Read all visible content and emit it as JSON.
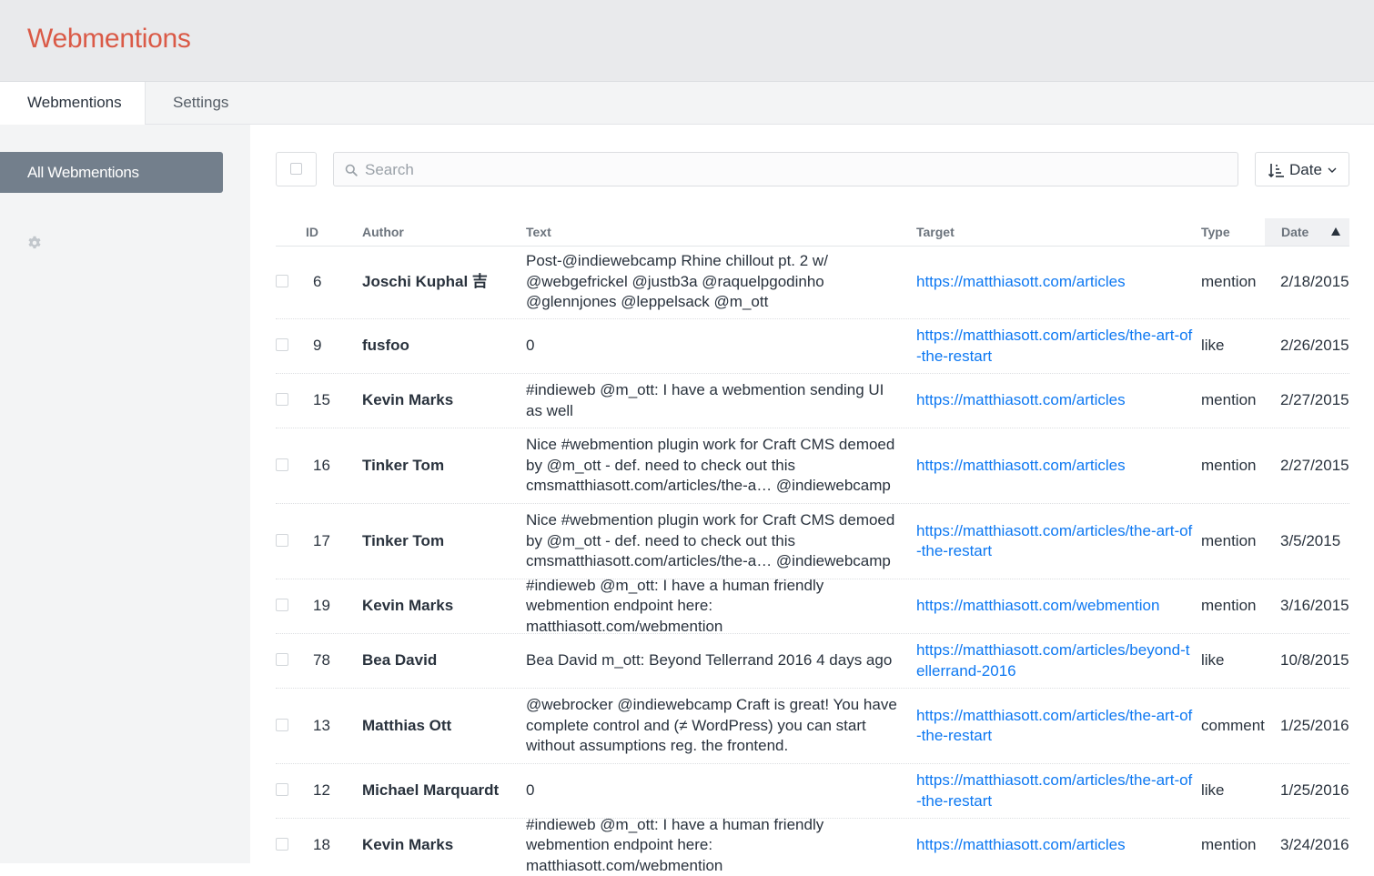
{
  "app": {
    "title": "Webmentions"
  },
  "tabs": [
    {
      "label": "Webmentions"
    },
    {
      "label": "Settings"
    }
  ],
  "sidebar": {
    "items": [
      {
        "label": "All Webmentions"
      }
    ],
    "settings_icon": "gear-icon"
  },
  "toolbar": {
    "search": {
      "placeholder": "Search",
      "value": ""
    },
    "sort": {
      "label": "Date",
      "icon": "sort-ascending-icon"
    }
  },
  "table": {
    "columns": {
      "id": "ID",
      "author": "Author",
      "text": "Text",
      "target": "Target",
      "type": "Type",
      "date": "Date"
    },
    "sorted_by": "Date",
    "sort_direction": "ascending",
    "rows": [
      {
        "id": "6",
        "author": "Joschi Kuphal 吉",
        "text": "Post-@indiewebcamp Rhine chillout pt. 2 w/ @webgefrickel @justb3a @raquelpgodinho @glennjones @leppelsack @m_ott",
        "target": "https://matthiasott.com/articles",
        "type": "mention",
        "date": "2/18/2015"
      },
      {
        "id": "9",
        "author": "fusfoo",
        "text": "0",
        "target": "https://matthiasott.com/articles/the-art-of-the-restart",
        "type": "like",
        "date": "2/26/2015"
      },
      {
        "id": "15",
        "author": "Kevin Marks",
        "text": "#indieweb @m_ott: I have a webmention sending UI as well",
        "target": "https://matthiasott.com/articles",
        "type": "mention",
        "date": "2/27/2015"
      },
      {
        "id": "16",
        "author": "Tinker Tom",
        "text": "Nice #webmention plugin work for Craft CMS demoed by @m_ott - def. need to check out this cmsmatthiasott.com/articles/the-a… @indiewebcamp",
        "target": "https://matthiasott.com/articles",
        "type": "mention",
        "date": "2/27/2015"
      },
      {
        "id": "17",
        "author": "Tinker Tom",
        "text": "Nice #webmention plugin work for Craft CMS demoed by @m_ott - def. need to check out this cmsmatthiasott.com/articles/the-a… @indiewebcamp",
        "target": "https://matthiasott.com/articles/the-art-of-the-restart",
        "type": "mention",
        "date": "3/5/2015"
      },
      {
        "id": "19",
        "author": "Kevin Marks",
        "text": "#indieweb @m_ott: I have a human friendly webmention endpoint here: matthiasott.com/webmention",
        "target": "https://matthiasott.com/webmention",
        "type": "mention",
        "date": "3/16/2015"
      },
      {
        "id": "78",
        "author": "Bea David",
        "text": "Bea David m_ott: Beyond Tellerrand 2016 4 days ago",
        "target": "https://matthiasott.com/articles/beyond-tellerrand-2016",
        "type": "like",
        "date": "10/8/2015"
      },
      {
        "id": "13",
        "author": "Matthias Ott",
        "text": "@webrocker @indiewebcamp Craft is great! You have complete control and (≠ WordPress) you can start without assumptions reg. the frontend.",
        "target": "https://matthiasott.com/articles/the-art-of-the-restart",
        "type": "comment",
        "date": "1/25/2016"
      },
      {
        "id": "12",
        "author": "Michael Marquardt",
        "text": "0",
        "target": "https://matthiasott.com/articles/the-art-of-the-restart",
        "type": "like",
        "date": "1/25/2016"
      },
      {
        "id": "18",
        "author": "Kevin Marks",
        "text": "#indieweb @m_ott: I have a human friendly webmention endpoint here: matthiasott.com/webmention",
        "target": "https://matthiasott.com/articles",
        "type": "mention",
        "date": "3/24/2016"
      }
    ]
  },
  "colors": {
    "brand": "#da5a47",
    "link": "#0d78f2",
    "sidebar_active": "#737f8c"
  }
}
